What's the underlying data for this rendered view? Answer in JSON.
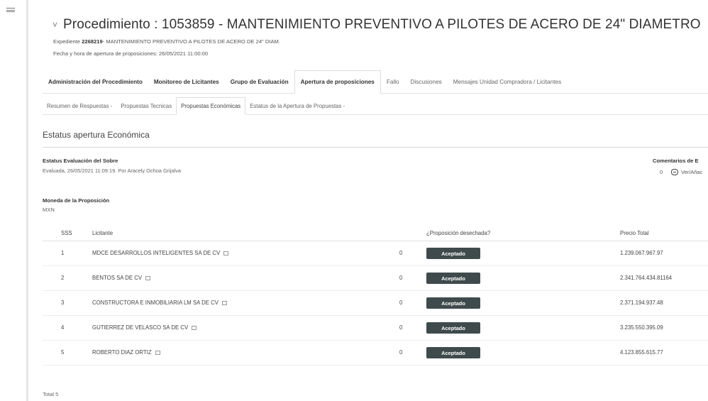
{
  "procedure": {
    "title": "Procedimiento : 1053859 - MANTENIMIENTO PREVENTIVO A PILOTES DE ACERO DE 24\" DIAMETRO",
    "expediente_label": "Expediente",
    "expediente_number": "2268219",
    "expediente_desc": "- MANTENIMIENTO PREVENTIVO A PILOTES DE ACERO DE 24\" DIAM.",
    "opening_datetime": "Fecha y hora de apertura de proposiciones: 26/05/2021 11:00:00"
  },
  "tabs": [
    {
      "label": "Administración del Procedimiento"
    },
    {
      "label": "Monitoreo de Licitantes"
    },
    {
      "label": "Grupo de Evaluación"
    },
    {
      "label": "Apertura de proposiciones"
    },
    {
      "label": "Fallo"
    },
    {
      "label": "Discusiones"
    },
    {
      "label": "Mensajes Unidad Compradora / Licitantes"
    }
  ],
  "subtabs": [
    {
      "label": "Resumen de Respuestas -"
    },
    {
      "label": "Propuestas Tecnicas"
    },
    {
      "label": "Propuestas Económicas"
    },
    {
      "label": "Estatus de la Apertura de Propuestas -"
    }
  ],
  "section_title": "Estatus apertura Económica",
  "evaluation": {
    "label": "Estatus Evaluación del Sobre",
    "value": "Evaluada, 26/05/2021 11:09:19. Por Aracely Ochoa Grijalva"
  },
  "comments": {
    "label": "Comentarios de E",
    "count": "0",
    "link": "Ver/Añac"
  },
  "currency": {
    "label": "Moneda de la Proposición",
    "value": "MXN"
  },
  "table": {
    "headers": {
      "idx": "SSS",
      "bidder": "Licitante",
      "rejected": "¿Proposición desechada?",
      "price": "Precio Total"
    },
    "rows": [
      {
        "idx": "1",
        "bidder": "MDCE DESARROLLOS INTELIGENTES SA DE CV",
        "zero": "0",
        "status": "Aceptado",
        "total": "1.239.067.967.97"
      },
      {
        "idx": "2",
        "bidder": "BENTOS SA DE CV",
        "zero": "0",
        "status": "Aceptado",
        "total": "2.341.764.434.81164"
      },
      {
        "idx": "3",
        "bidder": "CONSTRUCTORA E INMOBILIARIA LM SA DE CV",
        "zero": "0",
        "status": "Aceptado",
        "total": "2.371.194.937.48"
      },
      {
        "idx": "4",
        "bidder": "GUTIERREZ DE VELASCO SA DE CV",
        "zero": "0",
        "status": "Aceptado",
        "total": "3.235.550.395.09"
      },
      {
        "idx": "5",
        "bidder": "ROBERTO DIAZ ORTIZ",
        "zero": "0",
        "status": "Aceptado",
        "total": "4.123.855.615.77"
      }
    ],
    "total_label": "Total 5"
  },
  "icons": {
    "menu": "hamburger-menu-icon",
    "chevron": "chevron-down-icon",
    "link": "external-link-icon",
    "comment": "comment-icon"
  },
  "colors": {
    "badge_bg": "#3f4a4c",
    "badge_text": "#ffffff"
  }
}
